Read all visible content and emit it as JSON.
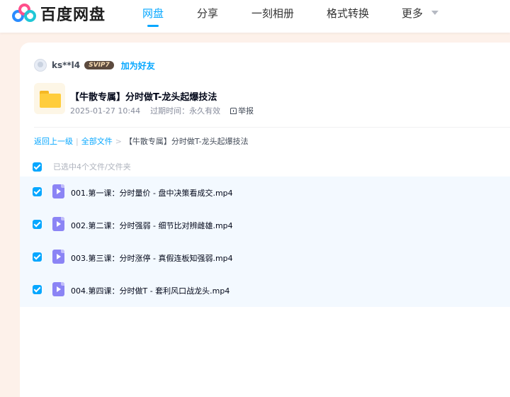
{
  "header": {
    "logo_text": "百度网盘",
    "nav": [
      {
        "label": "网盘",
        "active": true
      },
      {
        "label": "分享",
        "active": false
      },
      {
        "label": "一刻相册",
        "active": false
      },
      {
        "label": "格式转换",
        "active": false
      },
      {
        "label": "更多",
        "active": false
      }
    ]
  },
  "sharer": {
    "name": "ks**l4",
    "badge": "SVIP7",
    "add_friend": "加为好友"
  },
  "folder": {
    "title": "【牛散专属】分时做T-龙头起爆技法",
    "date": "2025-01-27 10:44",
    "expiry_label": "过期时间：永久有效",
    "report": "举报"
  },
  "breadcrumb": {
    "back": "返回上一级",
    "sep1": "|",
    "all_files": "全部文件",
    "sep2": ">",
    "current": "【牛散专属】分时做T-龙头起爆技法"
  },
  "selection": {
    "label": "已选中4个文件/文件夹"
  },
  "files": [
    {
      "name": "001.第一课：分时量价 - 盘中决策看成交.mp4",
      "checked": true
    },
    {
      "name": "002.第二课：分时强弱 - 细节比对辨雌雄.mp4",
      "checked": true
    },
    {
      "name": "003.第三课：分时涨停 - 真假连板知强弱.mp4",
      "checked": true
    },
    {
      "name": "004.第四课：分时做T - 套利风口战龙头.mp4",
      "checked": true
    }
  ],
  "colors": {
    "accent": "#06a7ff",
    "page_bg": "#fdf1ea",
    "list_bg": "#f3f9ff",
    "video_icon": "#8b84f5",
    "folder_icon": "#ffcd3c"
  }
}
